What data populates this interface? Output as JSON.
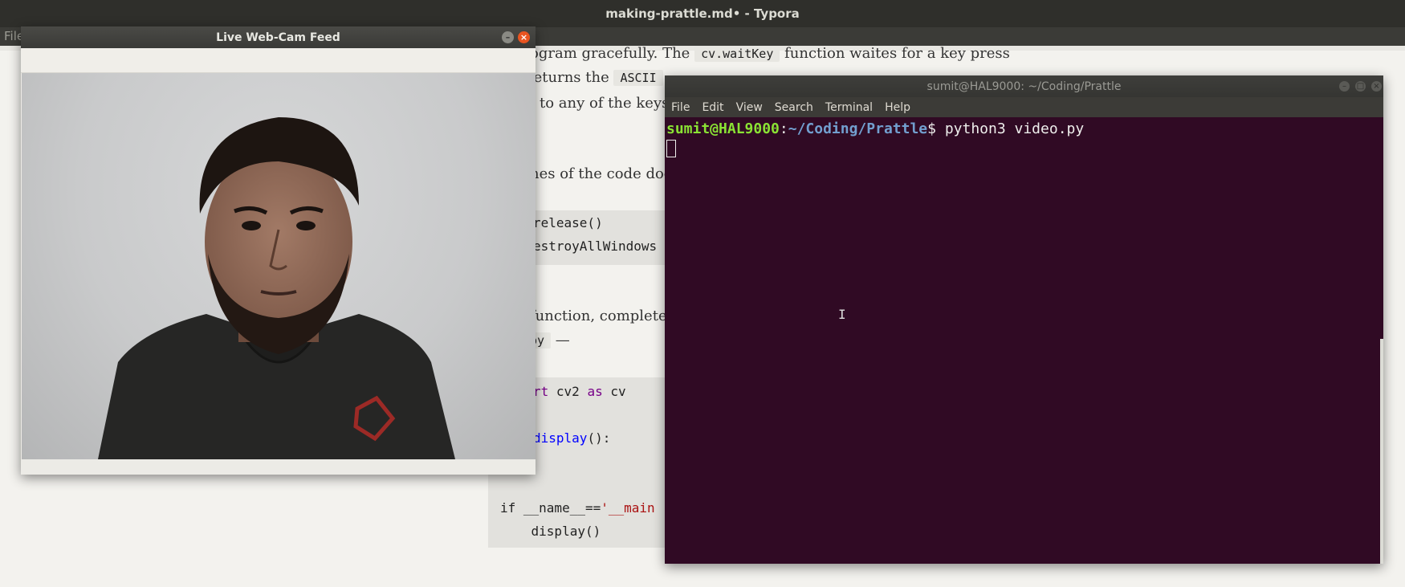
{
  "typora": {
    "title": "making-prattle.md• - Typora",
    "menu_file": "File",
    "para1_line1_a": "ogram gracefully. The",
    "para1_line1_code": "cv.waitKey",
    "para1_line1_b": "function waites for a key press",
    "para1_line2_a": "returns the",
    "para1_line2_code": "ASCII",
    "para1_line3": "s to any of the keys",
    "para2_line1": "nes of the code doe",
    "code1_line1": "release()",
    "code1_line2": "estroyAllWindows",
    "para3_line1": "function, complete",
    "para3_line2_code": "py",
    "para3_line2_b": "—",
    "code2_import_kw": "rt",
    "code2_import_rest": " cv2 ",
    "code2_as": "as",
    "code2_cv": " cv",
    "code2_def_fn": "display",
    "code2_def_rest": "():",
    "code2_if": "if __name__==",
    "code2_main_str": "'__main",
    "code2_call": "    display()"
  },
  "webcam": {
    "title": "Live Web-Cam Feed",
    "min_icon": "–",
    "close_icon": "×"
  },
  "terminal": {
    "title": "sumit@HAL9000: ~/Coding/Prattle",
    "menu": [
      "File",
      "Edit",
      "View",
      "Search",
      "Terminal",
      "Help"
    ],
    "prompt_user": "sumit@HAL9000",
    "prompt_sep": ":",
    "prompt_path": "~/Coding/Prattle",
    "prompt_dollar": "$ ",
    "command": "python3 video.py"
  }
}
